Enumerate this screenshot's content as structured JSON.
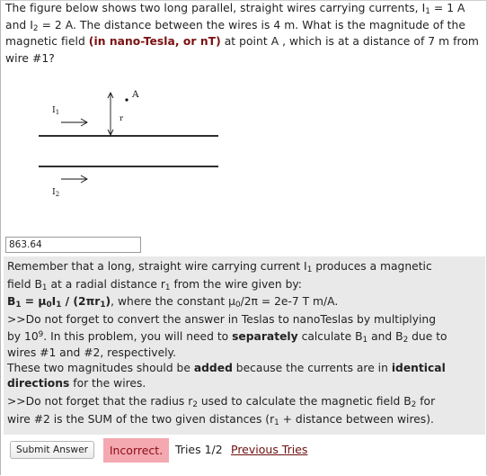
{
  "question": {
    "p1": "The figure below shows two long parallel, straight wires carrying currents, I",
    "p1_sub": "1",
    "p2": " = 1 A and I",
    "p2_sub": "2",
    "p3": " = 2 A. The distance between the wires is 4 m. What is the magnitude of the magnetic field ",
    "units_bold": "(in nano-Tesla, or nT)",
    "p4": " at point A , which is at a distance of 7 m from wire #1?"
  },
  "figure": {
    "point_label": "A",
    "r_label": "r",
    "i1_label": "I",
    "i1_sub": "1",
    "i2_label": "I",
    "i2_sub": "2"
  },
  "answer": {
    "value": "863.64"
  },
  "feedback": {
    "l1a": "Remember that a long, straight wire carrying current I",
    "l1s": "1",
    "l1b": " produces a magnetic",
    "l2a": "field B",
    "l2s": "1",
    "l2b": " at a radial distance r",
    "l2s2": "1",
    "l2c": " from the wire given by:",
    "l3f_a": "B",
    "l3f_s1": "1",
    "l3f_b": " = μ",
    "l3f_s2": "0",
    "l3f_c": "I",
    "l3f_s3": "1",
    "l3f_d": " / (2πr",
    "l3f_s4": "1",
    "l3f_e": ")",
    "l3_rest": ", where the constant μ",
    "l3_s": "0",
    "l3_rest2": "/2π = 2e-7 T m/A.",
    "l4": ">>Do not forget to convert the answer in Teslas to nanoTeslas by multiplying",
    "l5a": "by 10",
    "l5sup": "9",
    "l5b": ". In this problem, you will need to ",
    "l5bold": "separately",
    "l5c": " calculate B",
    "l5s1": "1",
    "l5d": " and B",
    "l5s2": "2",
    "l5e": " due to",
    "l6": "wires #1 and #2, respectively.",
    "l7a": "These two magnitudes should be ",
    "l7bold": "added",
    "l7b": " because the currents are in ",
    "l7bold2": "identical",
    "l8bold": "directions",
    "l8b": " for the wires.",
    "l9a": ">>Do not forget that the radius r",
    "l9s": "2",
    "l9b": " used to calculate the magnetic field B",
    "l9s2": "2",
    "l9c": " for",
    "l10a": "wire #2 is the SUM of the two given distances (r",
    "l10s": "1",
    "l10b": " + distance between wires)."
  },
  "controls": {
    "submit_label": "Submit Answer",
    "status_text": "Incorrect.",
    "tries_text": "Tries 1/2",
    "previous_tries_label": "Previous Tries"
  },
  "colors": {
    "units_highlight": "#7a1010",
    "feedback_bg": "#e9e9e9",
    "incorrect_bg": "#f4a8b0",
    "incorrect_text": "#8b0a14",
    "link": "#6d0f0f"
  }
}
